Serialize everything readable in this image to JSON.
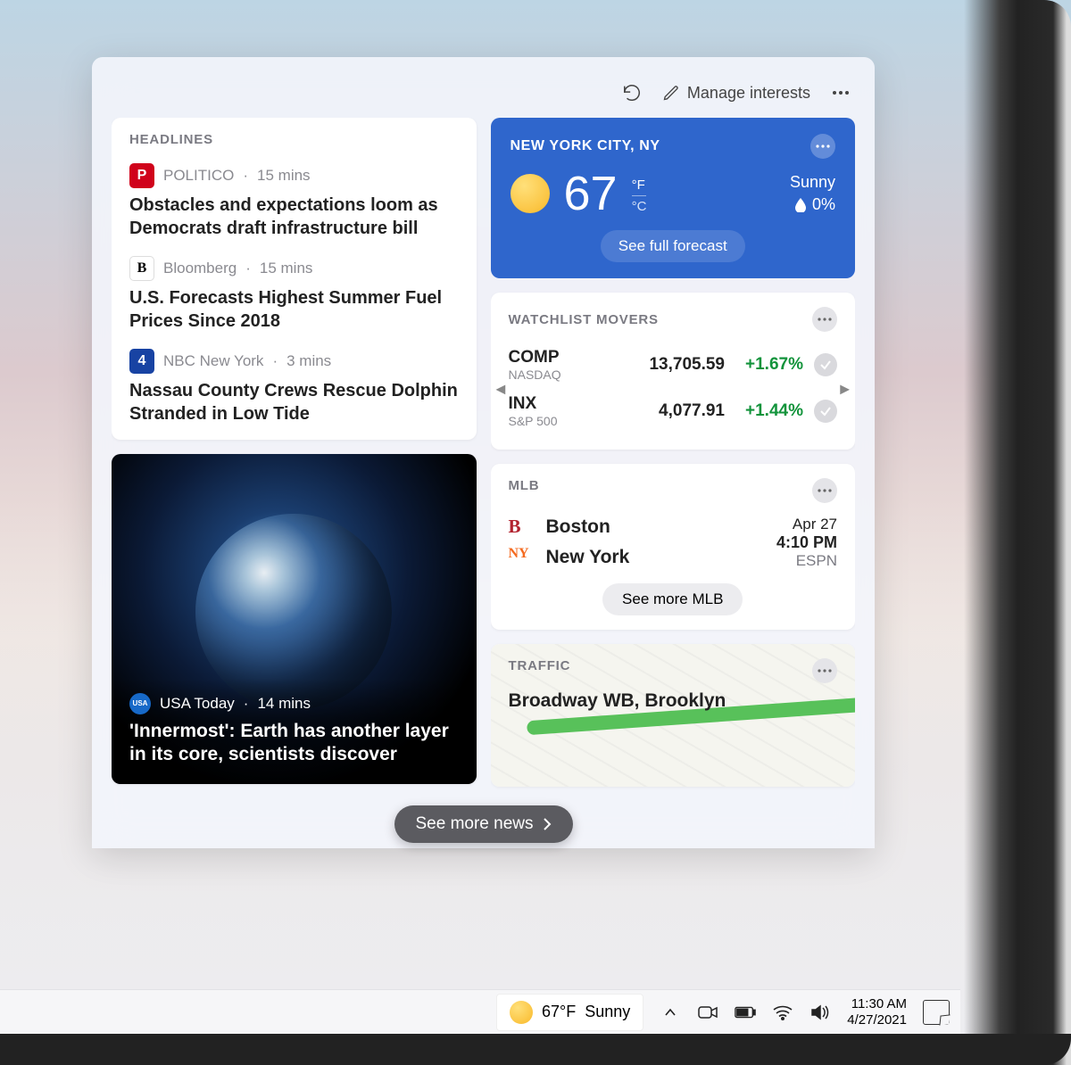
{
  "toolbar": {
    "manage_label": "Manage interests"
  },
  "headlines": {
    "header": "HEADLINES",
    "items": [
      {
        "badge": "P",
        "badge_bg": "#d0021b",
        "source": "POLITICO",
        "time": "15 mins",
        "title": "Obstacles and expectations loom as Democrats draft infrastructure bill"
      },
      {
        "badge": "B",
        "badge_bg": "#ffffff",
        "badge_fg": "#000",
        "source": "Bloomberg",
        "time": "15 mins",
        "title": "U.S. Forecasts Highest Summer Fuel Prices Since 2018"
      },
      {
        "badge": "4",
        "badge_bg": "#1843a3",
        "source": "NBC New York",
        "time": "3 mins",
        "title": "Nassau County Crews Rescue Dolphin Stranded in Low Tide"
      }
    ]
  },
  "featured": {
    "source": "USA Today",
    "time": "14 mins",
    "title": "'Innermost': Earth has another layer in its core, scientists discover"
  },
  "weather": {
    "location": "NEW YORK CITY, NY",
    "temp": "67",
    "unit_f": "°F",
    "unit_c": "°C",
    "condition": "Sunny",
    "humidity": "0%",
    "forecast_btn": "See full forecast"
  },
  "watchlist": {
    "header": "WATCHLIST MOVERS",
    "rows": [
      {
        "ticker": "COMP",
        "exchange": "NASDAQ",
        "price": "13,705.59",
        "change": "+1.67%"
      },
      {
        "ticker": "INX",
        "exchange": "S&P 500",
        "price": "4,077.91",
        "change": "+1.44%"
      }
    ]
  },
  "mlb": {
    "header": "MLB",
    "teams": [
      {
        "name": "Boston",
        "logo": "B",
        "color": "#b2222e"
      },
      {
        "name": "New York",
        "logo": "NY",
        "color": "#f46a1f"
      }
    ],
    "date": "Apr 27",
    "time": "4:10 PM",
    "network": "ESPN",
    "see_more": "See more MLB"
  },
  "traffic": {
    "header": "TRAFFIC",
    "road": "Broadway WB, Brooklyn"
  },
  "see_more_news": "See more news",
  "taskbar": {
    "temp": "67°F",
    "condition": "Sunny",
    "time": "11:30 AM",
    "date": "4/27/2021"
  }
}
